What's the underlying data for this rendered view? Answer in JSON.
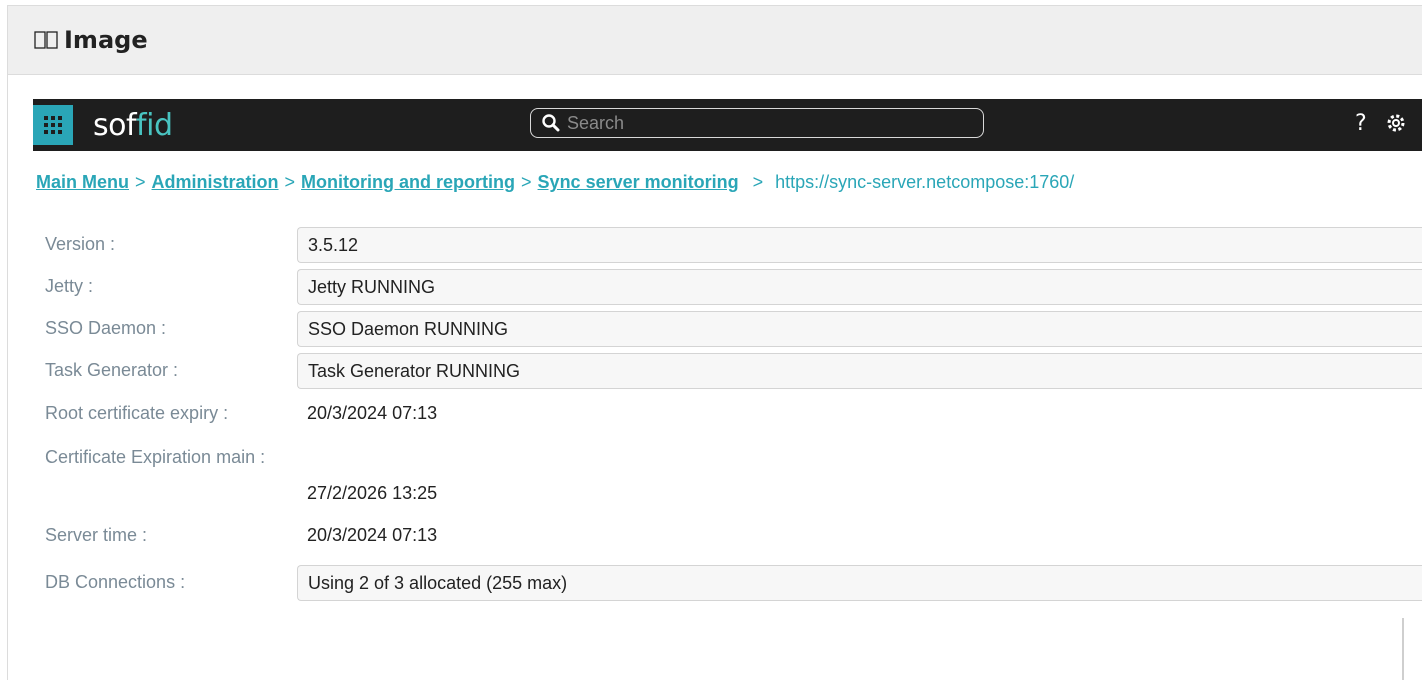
{
  "section": {
    "title": "Image",
    "icon": "image-icon"
  },
  "app": {
    "logo_part1": "so",
    "logo_part2": "f",
    "logo_part3": "fid",
    "search_placeholder": "Search",
    "help_label": "?",
    "accent_color": "#2aa6b7"
  },
  "breadcrumb": {
    "items": [
      "Main Menu",
      "Administration",
      "Monitoring and reporting",
      "Sync server monitoring"
    ],
    "separator": ">",
    "current": "https://sync-server.netcompose:1760/"
  },
  "fields": {
    "version": {
      "label": "Version :",
      "value": "3.5.12"
    },
    "jetty": {
      "label": "Jetty :",
      "value": "Jetty RUNNING"
    },
    "sso_daemon": {
      "label": "SSO Daemon :",
      "value": "SSO Daemon RUNNING"
    },
    "task_generator": {
      "label": "Task Generator :",
      "value": "Task Generator RUNNING"
    },
    "root_cert_expiry": {
      "label": "Root certificate expiry :",
      "value": "20/3/2024 07:13"
    },
    "cert_expiration_main": {
      "label": "Certificate Expiration main :",
      "value": "27/2/2026 13:25"
    },
    "server_time": {
      "label": "Server time :",
      "value": "20/3/2024 07:13"
    },
    "db_connections": {
      "label": "DB Connections :",
      "value": "Using 2 of 3 allocated (255 max)"
    }
  }
}
